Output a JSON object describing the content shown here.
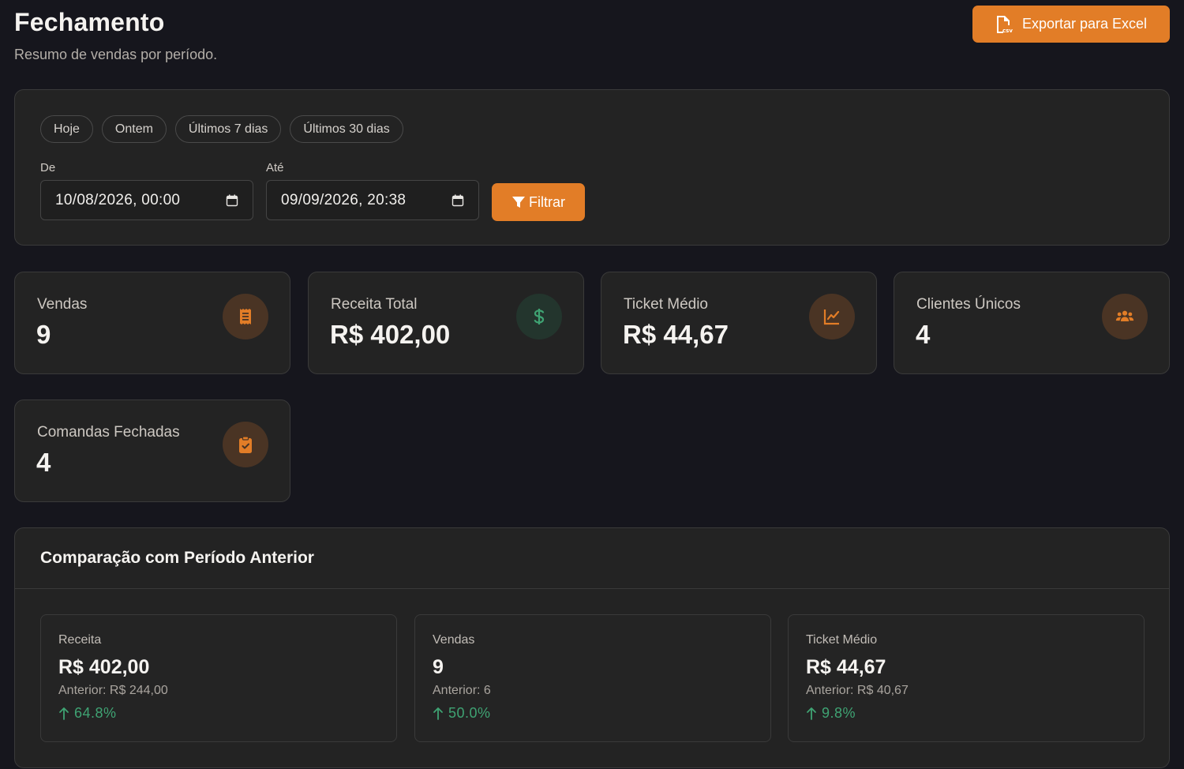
{
  "header": {
    "title": "Fechamento",
    "subtitle": "Resumo de vendas por período.",
    "export_label": "Exportar para Excel"
  },
  "filters": {
    "quick_ranges": [
      "Hoje",
      "Ontem",
      "Últimos 7 dias",
      "Últimos 30 dias"
    ],
    "from_label": "De",
    "from_value": "10/08/2026, 00:00",
    "to_label": "Até",
    "to_value": "09/09/2026, 20:38",
    "filter_button": "Filtrar"
  },
  "stats": [
    {
      "label": "Vendas",
      "value": "9",
      "icon": "receipt-icon"
    },
    {
      "label": "Receita Total",
      "value": "R$ 402,00",
      "icon": "dollar-icon"
    },
    {
      "label": "Ticket Médio",
      "value": "R$ 44,67",
      "icon": "chart-line-icon"
    },
    {
      "label": "Clientes Únicos",
      "value": "4",
      "icon": "users-icon"
    },
    {
      "label": "Comandas Fechadas",
      "value": "4",
      "icon": "clipboard-check-icon"
    }
  ],
  "comparison": {
    "title": "Comparação com Período Anterior",
    "cards": [
      {
        "label": "Receita",
        "value": "R$ 402,00",
        "previous": "Anterior: R$ 244,00",
        "change": "64.8%"
      },
      {
        "label": "Vendas",
        "value": "9",
        "previous": "Anterior: 6",
        "change": "50.0%"
      },
      {
        "label": "Ticket Médio",
        "value": "R$ 44,67",
        "previous": "Anterior: R$ 40,67",
        "change": "9.8%"
      }
    ]
  },
  "colors": {
    "accent": "#e27d27",
    "positive": "#3fa373",
    "background": "#16161d",
    "card": "#232323"
  }
}
